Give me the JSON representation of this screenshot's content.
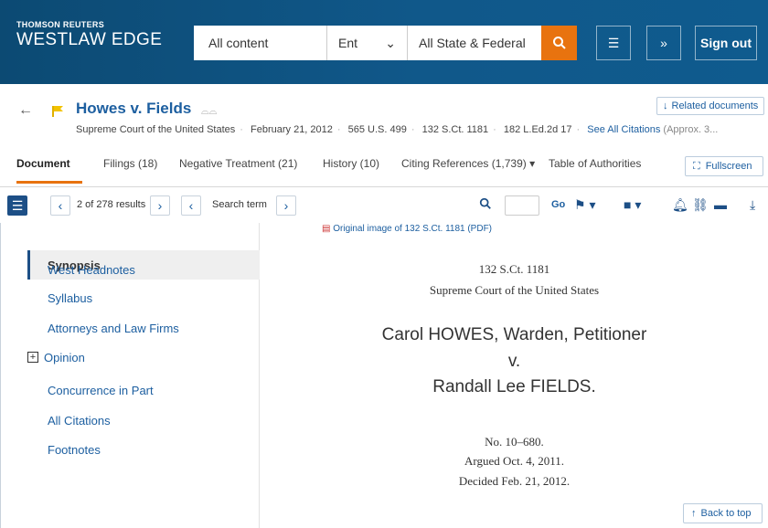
{
  "brand": {
    "small": "THOMSON REUTERS",
    "big": "WESTLAW EDGE"
  },
  "search": {
    "scope": "All content",
    "type": "Ent",
    "jurisdiction": "All State & Federal"
  },
  "header": {
    "sign_out": "Sign out"
  },
  "doc": {
    "title": "Howes v. Fields",
    "court": "Supreme Court of the United States",
    "date": "February 21, 2012",
    "cite1": "565 U.S. 499",
    "cite2": "132 S.Ct. 1181",
    "cite3": "182 L.Ed.2d 17",
    "see_all": "See All Citations",
    "approx": "(Approx. 3...",
    "related": "Related documents"
  },
  "tabs": [
    {
      "label": "Document"
    },
    {
      "label": "Filings (18)"
    },
    {
      "label": "Negative Treatment (21)"
    },
    {
      "label": "History (10)"
    },
    {
      "label": "Citing References (1,739)"
    },
    {
      "label": "Table of Authorities"
    }
  ],
  "fullscreen": "Fullscreen",
  "toolbar": {
    "results": "2 of 278 results",
    "search_term": "Search term",
    "go": "Go"
  },
  "sidebar": {
    "items": [
      {
        "label": "Synopsis"
      },
      {
        "label": "West Headnotes"
      },
      {
        "label": "Syllabus"
      },
      {
        "label": "Attorneys and Law Firms"
      },
      {
        "label": "Opinion"
      },
      {
        "label": "Concurrence in Part"
      },
      {
        "label": "All Citations"
      },
      {
        "label": "Footnotes"
      }
    ]
  },
  "content": {
    "pdf_link": "Original image of 132 S.Ct. 1181 (PDF)",
    "reporter": "132 S.Ct. 1181",
    "court": "Supreme Court of the United States",
    "party1": "Carol HOWES, Warden, Petitioner",
    "v": "v.",
    "party2": "Randall Lee FIELDS.",
    "docket": "No. 10–680.",
    "argued": "Argued Oct. 4, 2011.",
    "decided": "Decided Feb. 21, 2012.",
    "back_to_top": "Back to top"
  },
  "colors": {
    "header": "#0f5b8e",
    "accent": "#e8730f",
    "link": "#1d5fa0"
  }
}
